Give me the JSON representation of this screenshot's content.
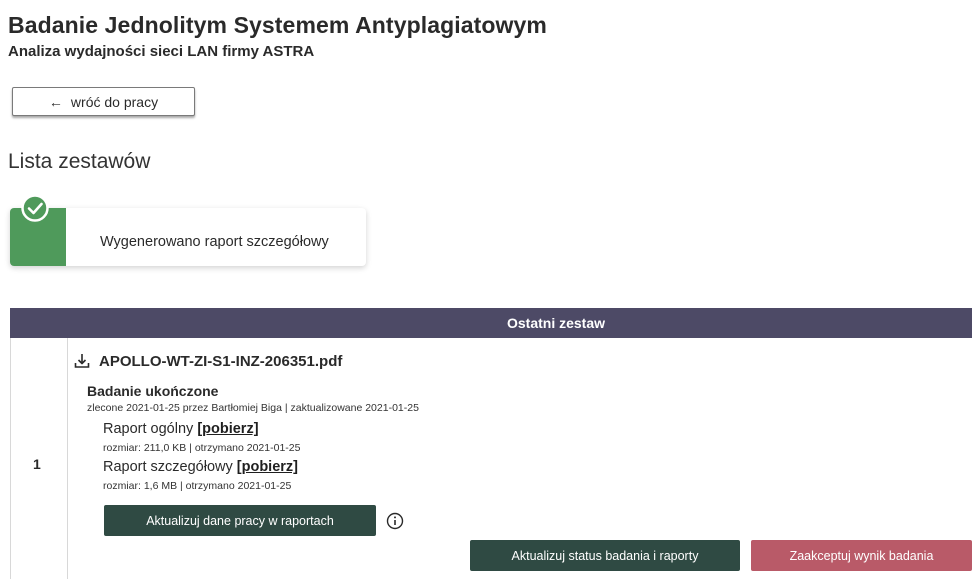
{
  "header": {
    "title": "Badanie Jednolitym Systemem Antyplagiatowym",
    "subtitle": "Analiza wydajności sieci LAN firmy ASTRA",
    "back_arrow": "←",
    "back_label": "wróć do pracy"
  },
  "section": {
    "title": "Lista zestawów"
  },
  "notification": {
    "icon": "check-circle-icon",
    "text": "Wygenerowano raport szczegółowy",
    "color": "#4f9a5b"
  },
  "table": {
    "header": "Ostatni zestaw",
    "header_color": "#4d4a66",
    "row": {
      "number": "1",
      "file_icon": "download-icon",
      "file_name": "APOLLO-WT-ZI-S1-INZ-206351.pdf",
      "status": "Badanie ukończone",
      "meta": "zlecone 2021-01-25 przez Bartłomiej Biga | zaktualizowane 2021-01-25",
      "report_general": {
        "label": "Raport ogólny ",
        "link": "[pobierz]",
        "meta": "rozmiar: 211,0 KB | otrzymano 2021-01-25"
      },
      "report_detailed": {
        "label": "Raport szczegółowy ",
        "link": "[pobierz]",
        "meta": "rozmiar: 1,6 MB | otrzymano 2021-01-25"
      },
      "update_data_button": "Aktualizuj dane pracy w raportach",
      "info_icon": "info-icon",
      "update_status_button": "Aktualizuj status badania i raporty",
      "accept_button": "Zaakceptuj wynik badania"
    }
  },
  "colors": {
    "dark_button": "#2f4a43",
    "accept_button": "#b95a68"
  }
}
